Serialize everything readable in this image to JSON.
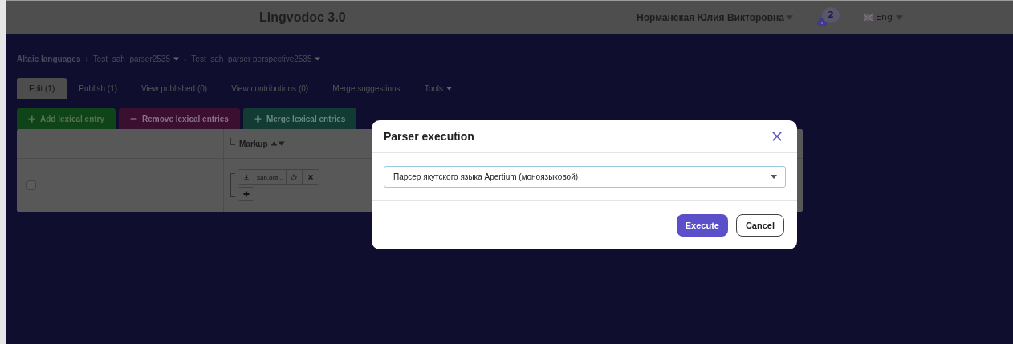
{
  "header": {
    "title": "Lingvodoc 3.0",
    "user": "Норманская Юлия Викторовна",
    "notifications": "2",
    "language": "Eng"
  },
  "breadcrumbs": [
    {
      "label": "Altaic languages",
      "dropdown": false
    },
    {
      "label": "Test_sah_parser2535",
      "dropdown": true,
      "separator": "›"
    },
    {
      "label": "Test_sah_parser perspective2535",
      "dropdown": true,
      "separator": "›"
    }
  ],
  "tabs": [
    {
      "label": "Edit (1)",
      "selected": true,
      "dropdown": false
    },
    {
      "label": "Publish (1)",
      "selected": false,
      "dropdown": false
    },
    {
      "label": "View published (0)",
      "selected": false,
      "dropdown": false
    },
    {
      "label": "View contributions (0)",
      "selected": false,
      "dropdown": false
    },
    {
      "label": "Merge suggestions",
      "selected": false,
      "dropdown": false
    },
    {
      "label": "Tools",
      "selected": false,
      "dropdown": true
    }
  ],
  "actions": [
    {
      "label": "Add lexical entry",
      "kind": "add"
    },
    {
      "label": "Remove lexical entries",
      "kind": "remove"
    },
    {
      "label": "Merge lexical entries",
      "kind": "merge"
    }
  ],
  "table": {
    "columns": [
      "Markup"
    ],
    "rows": [
      {
        "checked": false,
        "file": "sah.odt..."
      }
    ]
  },
  "dialog": {
    "title": "Parser execution",
    "select": {
      "value": "Парсер якутского языка Apertium (моноязыковой)"
    },
    "buttons": [
      {
        "label": "Execute",
        "kind": "primary"
      },
      {
        "label": "Cancel",
        "kind": "secondary"
      }
    ]
  }
}
